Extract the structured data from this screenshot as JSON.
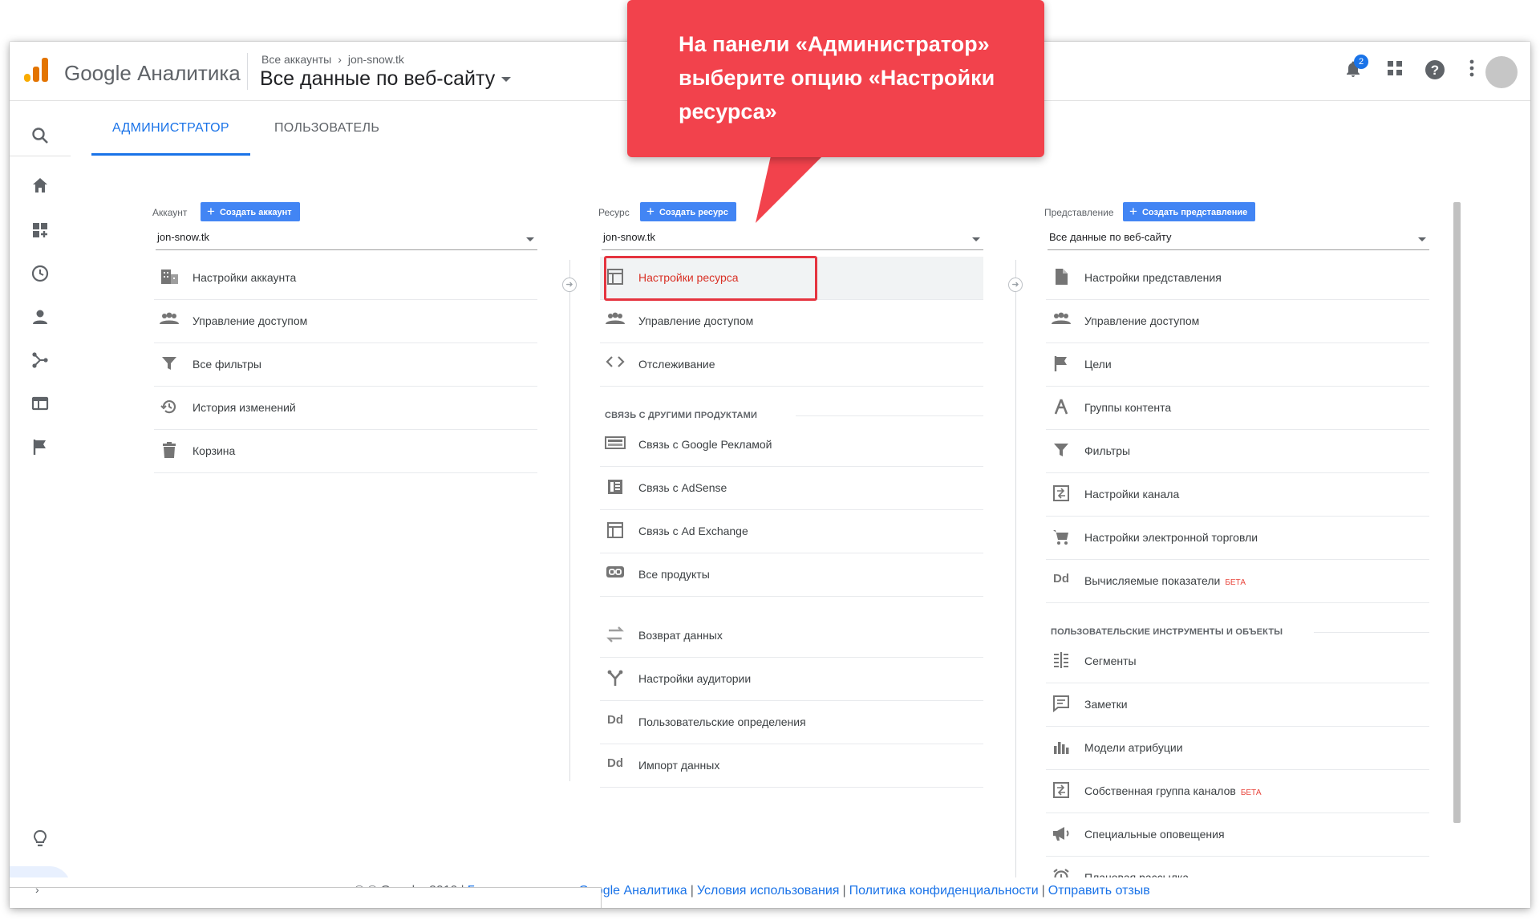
{
  "app": {
    "brand": "Google Аналитика",
    "breadcrumb_root": "Все аккаунты",
    "breadcrumb_account": "jon-snow.tk",
    "view_title": "Все данные по веб-сайту",
    "notification_count": "2"
  },
  "tabs": [
    {
      "label": "АДМИНИСТРАТОР",
      "active": true
    },
    {
      "label": "ПОЛЬЗОВАТЕЛЬ",
      "active": false
    }
  ],
  "sidebar_icons": [
    "search-icon",
    "home-icon",
    "customization-icon",
    "realtime-icon",
    "audience-icon",
    "acquisition-icon",
    "behavior-icon",
    "conversions-icon",
    "discover-icon",
    "admin-gear-icon"
  ],
  "account_column": {
    "heading": "Аккаунт",
    "create_label": "Создать аккаунт",
    "selected": "jon-snow.tk",
    "items": [
      {
        "label": "Настройки аккаунта",
        "icon": "building-icon"
      },
      {
        "label": "Управление доступом",
        "icon": "people-icon"
      },
      {
        "label": "Все фильтры",
        "icon": "filter-icon"
      },
      {
        "label": "История изменений",
        "icon": "history-icon"
      },
      {
        "label": "Корзина",
        "icon": "trash-icon"
      }
    ]
  },
  "property_column": {
    "heading": "Ресурс",
    "create_label": "Создать ресурс",
    "selected": "jon-snow.tk",
    "items": [
      {
        "label": "Настройки ресурса",
        "icon": "window-icon"
      },
      {
        "label": "Управление доступом",
        "icon": "people-icon"
      },
      {
        "label": "Отслеживание",
        "icon": "code-icon"
      }
    ],
    "links_heading": "СВЯЗЬ С ДРУГИМИ ПРОДУКТАМИ",
    "links": [
      {
        "label": "Связь с Google Рекламой",
        "icon": "ads-icon"
      },
      {
        "label": "Связь с AdSense",
        "icon": "adsense-icon"
      },
      {
        "label": "Связь с Ad Exchange",
        "icon": "adexchange-icon"
      },
      {
        "label": "Все продукты",
        "icon": "link-icon"
      }
    ],
    "more": [
      {
        "label": "Возврат данных",
        "icon": "retention-icon"
      },
      {
        "label": "Настройки аудитории",
        "icon": "audience-fork-icon"
      },
      {
        "label": "Пользовательские определения",
        "icon": "dd-icon"
      },
      {
        "label": "Импорт данных",
        "icon": "dd-icon"
      }
    ]
  },
  "view_column": {
    "heading": "Представление",
    "create_label": "Создать представление",
    "selected": "Все данные по веб-сайту",
    "items": [
      {
        "label": "Настройки представления",
        "icon": "document-icon",
        "beta": ""
      },
      {
        "label": "Управление доступом",
        "icon": "people-icon",
        "beta": ""
      },
      {
        "label": "Цели",
        "icon": "flag-icon",
        "beta": ""
      },
      {
        "label": "Группы контента",
        "icon": "content-groups-icon",
        "beta": ""
      },
      {
        "label": "Фильтры",
        "icon": "filter-icon",
        "beta": ""
      },
      {
        "label": "Настройки канала",
        "icon": "channel-icon",
        "beta": ""
      },
      {
        "label": "Настройки электронной торговли",
        "icon": "cart-icon",
        "beta": ""
      },
      {
        "label": "Вычисляемые показатели",
        "icon": "dd-icon",
        "beta": "БЕТА"
      }
    ],
    "tools_heading": "ПОЛЬЗОВАТЕЛЬСКИЕ ИНСТРУМЕНТЫ И ОБЪЕКТЫ",
    "tools": [
      {
        "label": "Сегменты",
        "icon": "segments-icon",
        "beta": ""
      },
      {
        "label": "Заметки",
        "icon": "notes-icon",
        "beta": ""
      },
      {
        "label": "Модели атрибуции",
        "icon": "bar-chart-icon",
        "beta": ""
      },
      {
        "label": "Собственная группа каналов",
        "icon": "channel-icon",
        "beta": "БЕТА"
      },
      {
        "label": "Специальные оповещения",
        "icon": "megaphone-icon",
        "beta": ""
      },
      {
        "label": "Плановая рассылка",
        "icon": "alarm-icon",
        "beta": ""
      }
    ]
  },
  "callout": {
    "text": "На панели «Администратор» выберите опцию «Настройки ресурса»"
  },
  "footer": {
    "copyright": "© © Google, 2019",
    "links": [
      "Главная страница Google Аналитика",
      "Условия использования",
      "Политика конфиденциальности",
      "Отправить отзыв"
    ]
  },
  "colors": {
    "accent": "#1a73e8",
    "button": "#4285f4",
    "callout": "#f2424c",
    "selected_text": "#d93025"
  }
}
